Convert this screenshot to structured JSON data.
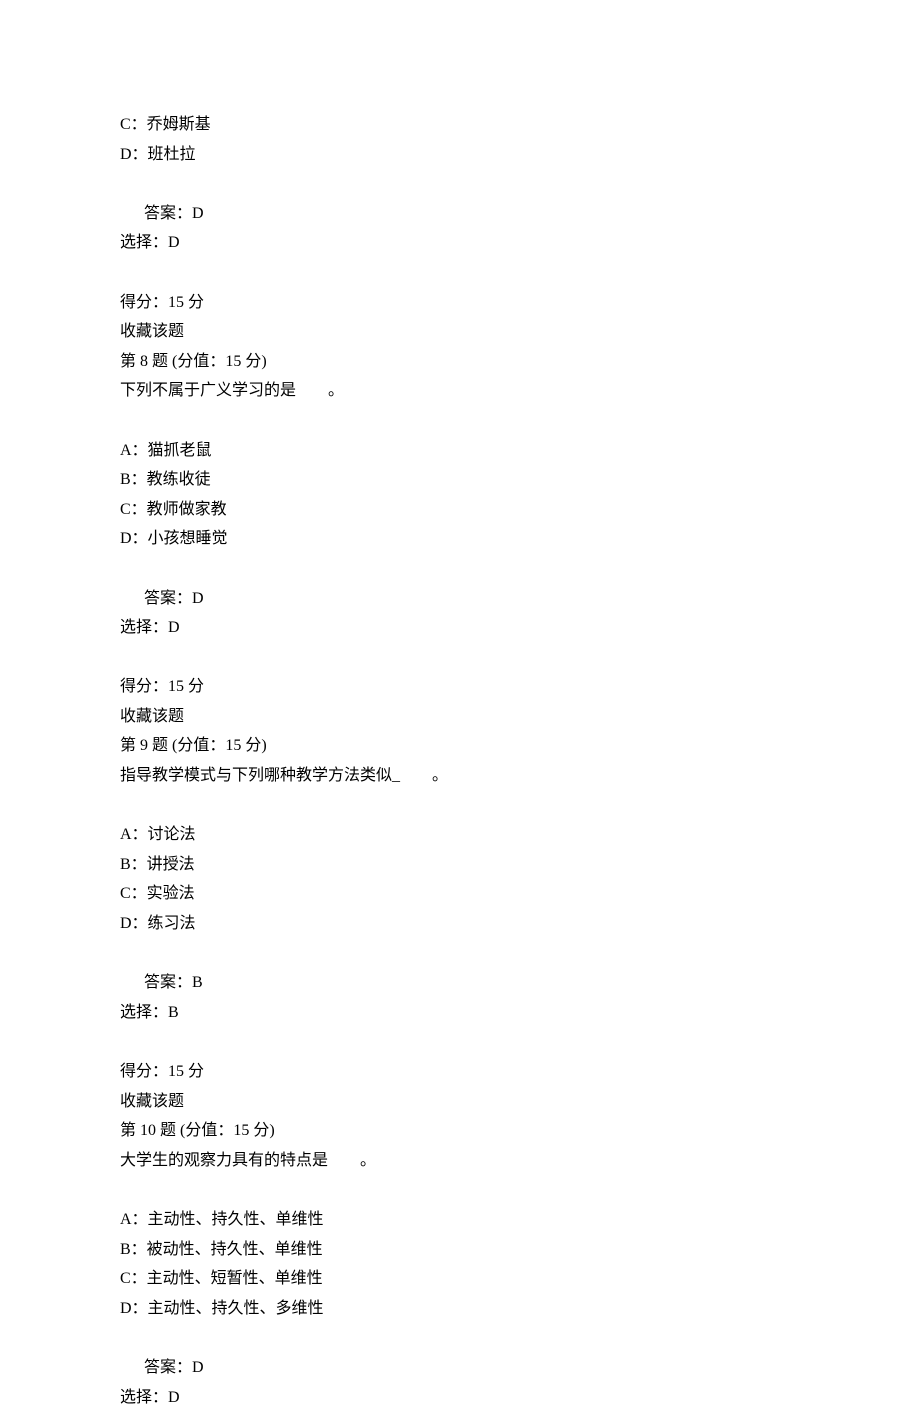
{
  "q7_tail": {
    "options": [
      "C：乔姆斯基",
      "D：班杜拉"
    ],
    "answer_label": "答案：",
    "answer": "D",
    "choice_label": "选择：",
    "choice": "D"
  },
  "q8": {
    "score_label": "得分：",
    "score": "15 分",
    "favorite": "收藏该题",
    "header": "第 8 题 (分值：15 分)",
    "stem": "下列不属于广义学习的是        。",
    "options": [
      "A：猫抓老鼠",
      "B：教练收徒",
      "C：教师做家教",
      "D：小孩想睡觉"
    ],
    "answer_label": "答案：",
    "answer": "D",
    "choice_label": "选择：",
    "choice": "D"
  },
  "q9": {
    "score_label": "得分：",
    "score": "15 分",
    "favorite": "收藏该题",
    "header": "第 9 题 (分值：15 分)",
    "stem": "指导教学模式与下列哪种教学方法类似_        。",
    "options": [
      "A：讨论法",
      "B：讲授法",
      "C：实验法",
      "D：练习法"
    ],
    "answer_label": "答案：",
    "answer": "B",
    "choice_label": "选择：",
    "choice": "B"
  },
  "q10": {
    "score_label": "得分：",
    "score": "15 分",
    "favorite": "收藏该题",
    "header": "第 10 题 (分值：15 分)",
    "stem": "大学生的观察力具有的特点是        。",
    "options": [
      "A：主动性、持久性、单维性",
      "B：被动性、持久性、单维性",
      "C：主动性、短暂性、单维性",
      "D：主动性、持久性、多维性"
    ],
    "answer_label": "答案：",
    "answer": "D",
    "choice_label": "选择：",
    "choice": "D"
  }
}
